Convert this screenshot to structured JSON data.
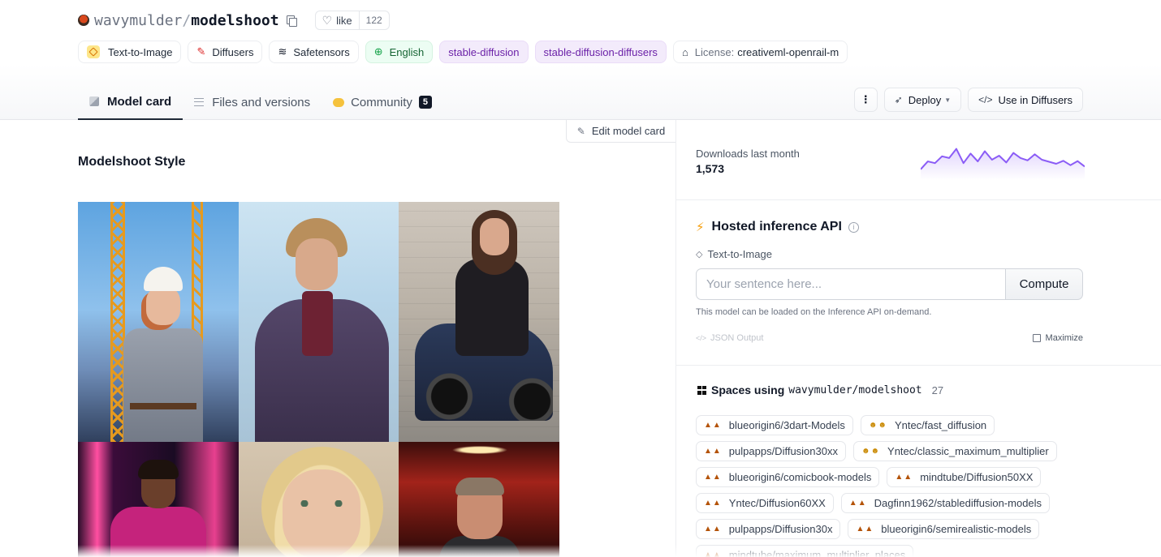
{
  "repo": {
    "owner": "wavymulder",
    "separator": "/",
    "name": "modelshoot",
    "like_label": "like",
    "like_count": "122"
  },
  "tags": [
    {
      "label": "Text-to-Image",
      "kind": "pipeline",
      "icon": "pipeline-icon"
    },
    {
      "label": "Diffusers",
      "kind": "library",
      "icon": "diffusers-icon"
    },
    {
      "label": "Safetensors",
      "kind": "library",
      "icon": "safetensors-icon"
    },
    {
      "label": "English",
      "kind": "language",
      "icon": "globe-icon"
    },
    {
      "label": "stable-diffusion",
      "kind": "other"
    },
    {
      "label": "stable-diffusion-diffusers",
      "kind": "other"
    },
    {
      "prefix": "License:",
      "label": "creativeml-openrail-m",
      "kind": "license",
      "icon": "bank-icon"
    }
  ],
  "tabs": [
    {
      "label": "Model card",
      "active": true,
      "icon": "cube-icon"
    },
    {
      "label": "Files and versions",
      "active": false,
      "icon": "files-icon"
    },
    {
      "label": "Community",
      "active": false,
      "icon": "community-icon",
      "badge": "5"
    }
  ],
  "actions": {
    "more_label": "⋮",
    "deploy_label": "Deploy",
    "use_label": "Use in Diffusers"
  },
  "model_card": {
    "edit_label": "Edit model card",
    "heading": "Modelshoot Style"
  },
  "downloads": {
    "label": "Downloads last month",
    "value": "1,573",
    "trend": [
      0.22,
      0.45,
      0.4,
      0.6,
      0.55,
      0.82,
      0.4,
      0.68,
      0.45,
      0.75,
      0.5,
      0.62,
      0.42,
      0.7,
      0.55,
      0.48,
      0.66,
      0.5,
      0.44,
      0.38,
      0.47,
      0.34,
      0.46,
      0.3
    ]
  },
  "inference": {
    "title": "Hosted inference API",
    "pipeline": "Text-to-Image",
    "placeholder": "Your sentence here...",
    "compute_label": "Compute",
    "note": "This model can be loaded on the Inference API on-demand.",
    "json_label": "JSON Output",
    "maximize_label": "Maximize"
  },
  "spaces": {
    "label": "Spaces using",
    "repo": "wavymulder/modelshoot",
    "count": "27",
    "items": [
      {
        "name": "blueorigin6/3dart-Models",
        "emoji": "▲▲"
      },
      {
        "name": "Yntec/fast_diffusion",
        "emoji": "☻☻"
      },
      {
        "name": "pulpapps/Diffusion30xx",
        "emoji": "▲▲"
      },
      {
        "name": "Yntec/classic_maximum_multiplier",
        "emoji": "☻☻"
      },
      {
        "name": "blueorigin6/comicbook-models",
        "emoji": "▲▲"
      },
      {
        "name": "mindtube/Diffusion50XX",
        "emoji": "▲▲"
      },
      {
        "name": "Yntec/Diffusion60XX",
        "emoji": "▲▲"
      },
      {
        "name": "Dagfinn1962/stablediffusion-models",
        "emoji": "▲▲"
      },
      {
        "name": "pulpapps/Diffusion30x",
        "emoji": "▲▲"
      },
      {
        "name": "blueorigin6/semirealistic-models",
        "emoji": "▲▲"
      },
      {
        "name": "mindtube/maximum_multiplier_places",
        "emoji": "▲▲"
      }
    ]
  },
  "colors": {
    "accent": "#8b5cf6",
    "badge_bg": "#111827"
  }
}
